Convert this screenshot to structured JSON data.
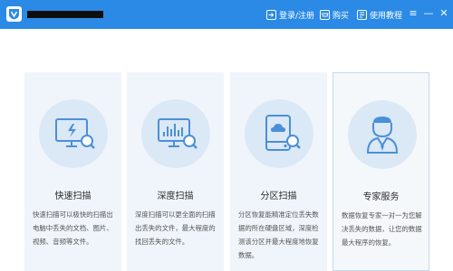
{
  "header": {
    "nav": {
      "login": "登录/注册",
      "buy": "购买",
      "tutorial": "使用教程"
    },
    "window": {
      "menu": "≡",
      "minimize": "—",
      "close": "✕"
    },
    "colors": {
      "bar": "#2b8ae6",
      "icon": "#4a90d9"
    }
  },
  "cards": [
    {
      "icon": "monitor-scan-icon",
      "title": "快速扫描",
      "description": "快速扫描可以极快的扫描出电脑中丢失的文档、图片、视频、音频等文件。"
    },
    {
      "icon": "chart-scan-icon",
      "title": "深度扫描",
      "description": "深度扫描可以更全面的扫描出丢失的文件，最大程度的找回丢失的文件。"
    },
    {
      "icon": "disk-scan-icon",
      "title": "分区扫描",
      "description": "分区恢复能精准定位丢失数据的所在硬盘区域，深度检测该分区并最大程度地恢复数据。"
    },
    {
      "icon": "expert-service-icon",
      "title": "专家服务",
      "description": "数据恢复专家一对一为您解决丢失的数据，让您的数据最大程序的恢复。"
    }
  ]
}
